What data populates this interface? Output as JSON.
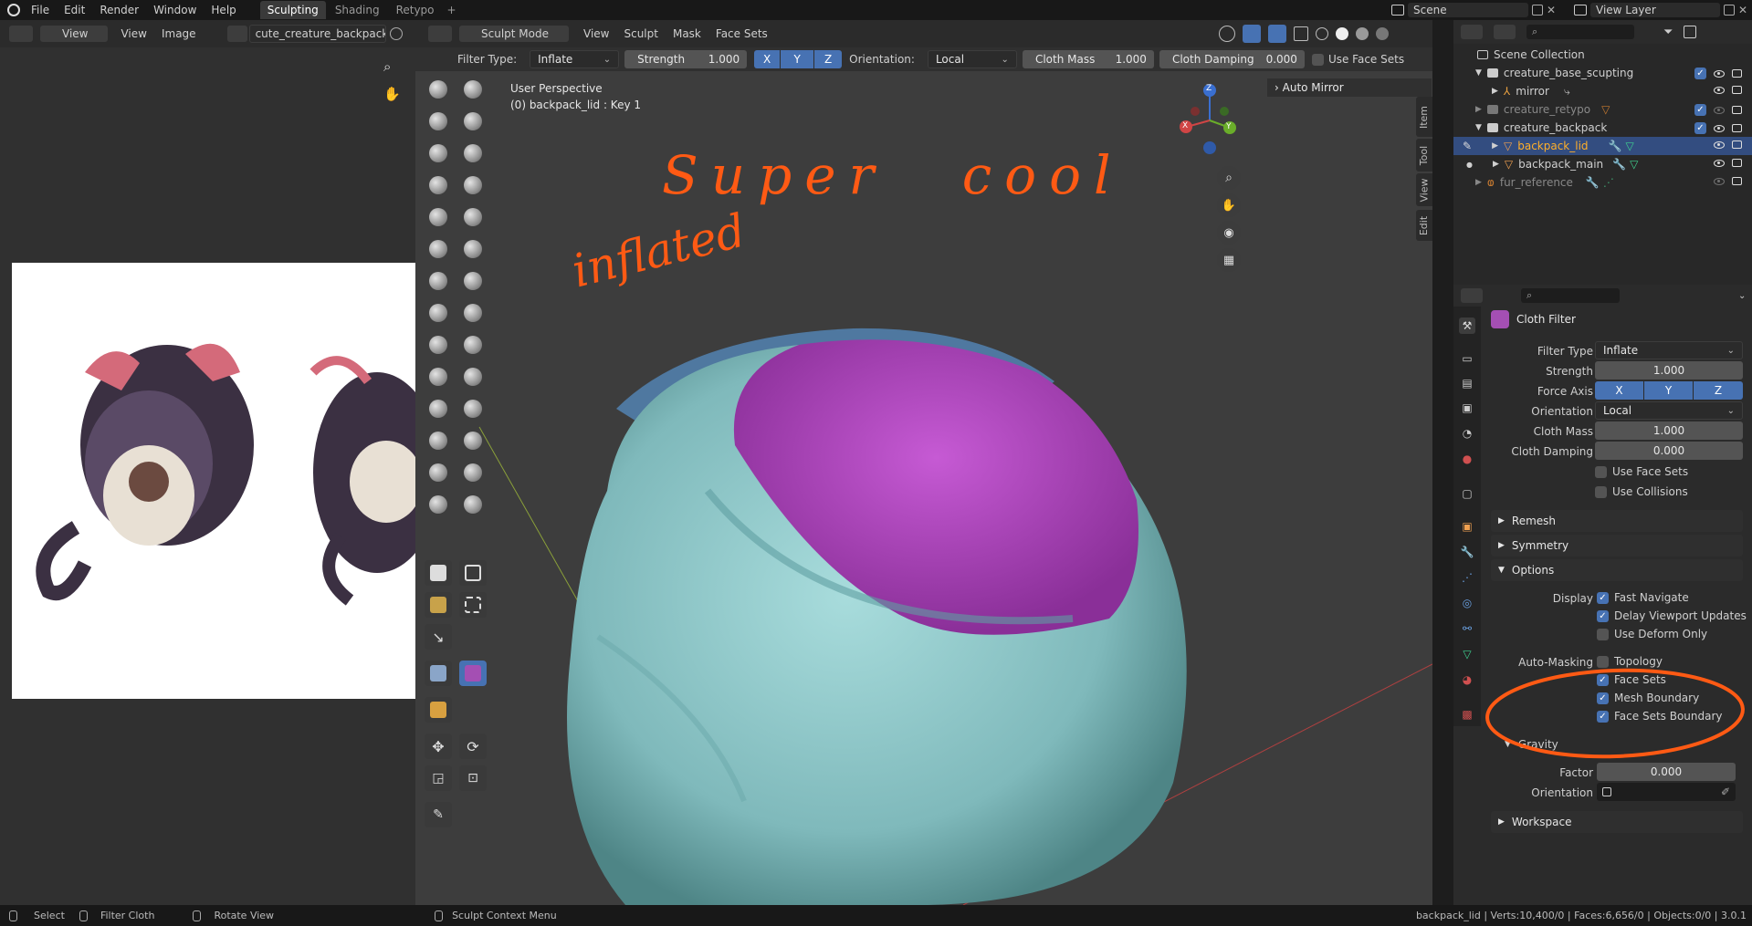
{
  "topbar": {
    "menus": [
      "File",
      "Edit",
      "Render",
      "Window",
      "Help"
    ],
    "workspaces": [
      "Sculpting",
      "Shading",
      "Retypo"
    ],
    "active_workspace": "Sculpting",
    "add_tab": "+",
    "scene": "Scene",
    "view_layer": "View Layer"
  },
  "image_editor": {
    "view_menu": "View",
    "menus": [
      "View",
      "Image"
    ],
    "image_name": "cute_creature_backpack.jpg"
  },
  "viewport_header": {
    "mode": "Sculpt Mode",
    "menus": [
      "View",
      "Sculpt",
      "Mask",
      "Face Sets"
    ]
  },
  "tool_settings": {
    "filter_type_label": "Filter Type:",
    "filter_type": "Inflate",
    "strength_label": "Strength",
    "strength": "1.000",
    "axes": [
      "X",
      "Y",
      "Z"
    ],
    "orientation_label": "Orientation:",
    "orientation": "Local",
    "cloth_mass_label": "Cloth Mass",
    "cloth_mass": "1.000",
    "cloth_damping_label": "Cloth Damping",
    "cloth_damping": "0.000",
    "use_face_sets": "Use Face Sets"
  },
  "viewport": {
    "perspective": "User Perspective",
    "object_info": "(0) backpack_lid : Key 1",
    "auto_mirror": "Auto Mirror",
    "annotation_1": "Super cool",
    "annotation_2": "inflated",
    "gizmo": {
      "x": "X",
      "y": "Y",
      "z": "Z"
    },
    "vtabs": [
      "Item",
      "Tool",
      "View",
      "Edit"
    ]
  },
  "outliner": {
    "root": "Scene Collection",
    "rows": [
      {
        "name": "creature_base_scupting",
        "type": "collection",
        "depth": 1
      },
      {
        "name": "mirror",
        "type": "empty",
        "depth": 2
      },
      {
        "name": "creature_retypo",
        "type": "collection",
        "depth": 1,
        "dim": true
      },
      {
        "name": "creature_backpack",
        "type": "collection",
        "depth": 1
      },
      {
        "name": "backpack_lid",
        "type": "mesh",
        "depth": 2,
        "selected": true
      },
      {
        "name": "backpack_main",
        "type": "mesh",
        "depth": 2
      },
      {
        "name": "fur_reference",
        "type": "curves",
        "depth": 1,
        "dim": true
      }
    ]
  },
  "properties": {
    "panel_title": "Cloth Filter",
    "filter_type_label": "Filter Type",
    "filter_type": "Inflate",
    "strength_label": "Strength",
    "strength": "1.000",
    "force_axis_label": "Force Axis",
    "axes": [
      "X",
      "Y",
      "Z"
    ],
    "orientation_label": "Orientation",
    "orientation": "Local",
    "cloth_mass_label": "Cloth Mass",
    "cloth_mass": "1.000",
    "cloth_damping_label": "Cloth Damping",
    "cloth_damping": "0.000",
    "use_face_sets": "Use Face Sets",
    "use_collisions": "Use Collisions",
    "sections": {
      "remesh": "Remesh",
      "symmetry": "Symmetry",
      "options": "Options",
      "workspace": "Workspace"
    },
    "display_label": "Display",
    "fast_navigate": "Fast Navigate",
    "delay_updates": "Delay Viewport Updates",
    "use_deform_only": "Use Deform Only",
    "auto_masking_label": "Auto-Masking",
    "topology": "Topology",
    "face_sets": "Face Sets",
    "mesh_boundary": "Mesh Boundary",
    "face_sets_boundary": "Face Sets Boundary",
    "gravity": "Gravity",
    "factor_label": "Factor",
    "factor": "0.000",
    "orientation2_label": "Orientation"
  },
  "statusbar": {
    "select": "Select",
    "filter_cloth": "Filter Cloth",
    "rotate_view": "Rotate View",
    "context_menu": "Sculpt Context Menu",
    "stats": "backpack_lid | Verts:10,400/0 | Faces:6,656/0 | Objects:0/0 | 3.0.1"
  },
  "colors": {
    "accent": "#4772b3",
    "annotation": "#ff5a14",
    "mesh_teal": "#8fc6c8",
    "mesh_purple": "#b13fc1"
  }
}
